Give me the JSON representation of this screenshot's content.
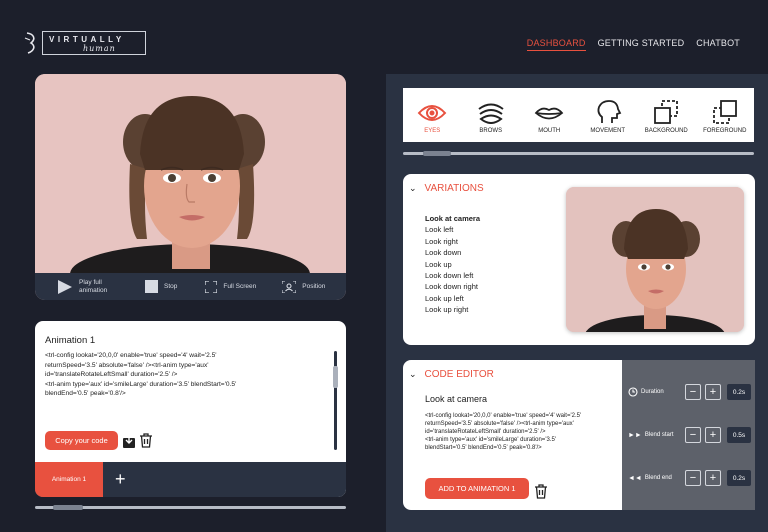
{
  "brand": {
    "word1": "VIRTUALLY",
    "word2": "human"
  },
  "nav": {
    "items": [
      "DASHBOARD",
      "GETTING STARTED",
      "CHATBOT"
    ],
    "active": "DASHBOARD"
  },
  "player": {
    "play_label": "Play full animation",
    "stop_label": "Stop",
    "fullscreen_label": "Full Screen",
    "position_label": "Position"
  },
  "animation_panel": {
    "title": "Animation 1",
    "code": "<trl-config lookat='20,0,0' enable='true' speed='4' wait='2.5'\nreturnSpeed='3.5' absolute='false' /><trl-anim type='aux'\nid='translateRotateLeftSmall' duration='2.5' />\n<trl-anim type='aux' id='smileLarge' duration='3.5' blendStart='0.5'\nblendEnd='0.5' peak='0.8'/>",
    "copy_label": "Copy your code",
    "tab_label": "Animation 1",
    "add_tab_label": "+"
  },
  "features": [
    {
      "label": "EYES",
      "icon": "eye-icon",
      "active": true
    },
    {
      "label": "BROWS",
      "icon": "brows-icon",
      "active": false
    },
    {
      "label": "MOUTH",
      "icon": "mouth-icon",
      "active": false
    },
    {
      "label": "MOVEMENT",
      "icon": "head-movement-icon",
      "active": false
    },
    {
      "label": "BACKGROUND",
      "icon": "background-layer-icon",
      "active": false
    },
    {
      "label": "FOREGROUND",
      "icon": "foreground-layer-icon",
      "active": false
    }
  ],
  "variations": {
    "title": "VARIATIONS",
    "items": [
      "Look at camera",
      "Look left",
      "Look right",
      "Look down",
      "Look up",
      "Look down left",
      "Look down right",
      "Look up left",
      "Look up right"
    ],
    "selected_index": 0
  },
  "code_editor": {
    "title": "CODE EDITOR",
    "subtitle": "Look at camera",
    "code": "<trl-config lookat='20,0,0' enable='true' speed='4' wait='2.5'\nreturnSpeed='3.5' absolute='false' /><trl-anim type='aux'\nid='translateRotateLeftSmall' duration='2.5' />\n<trl-anim type='aux' id='smileLarge' duration='3.5'\nblendStart='0.5' blendEnd='0.5' peak='0.8'/>",
    "add_label": "ADD TO ANIMATION 1",
    "settings": [
      {
        "label": "Duration",
        "value": "0.2s",
        "icon": "clock-icon"
      },
      {
        "label": "Blend start",
        "value": "0.5s",
        "icon": "fast-forward-icon"
      },
      {
        "label": "Blend end",
        "value": "0.2s",
        "icon": "rewind-icon"
      }
    ]
  },
  "colors": {
    "accent": "#e8513f",
    "navy": "#2a3242",
    "background": "#1c1f2b"
  }
}
